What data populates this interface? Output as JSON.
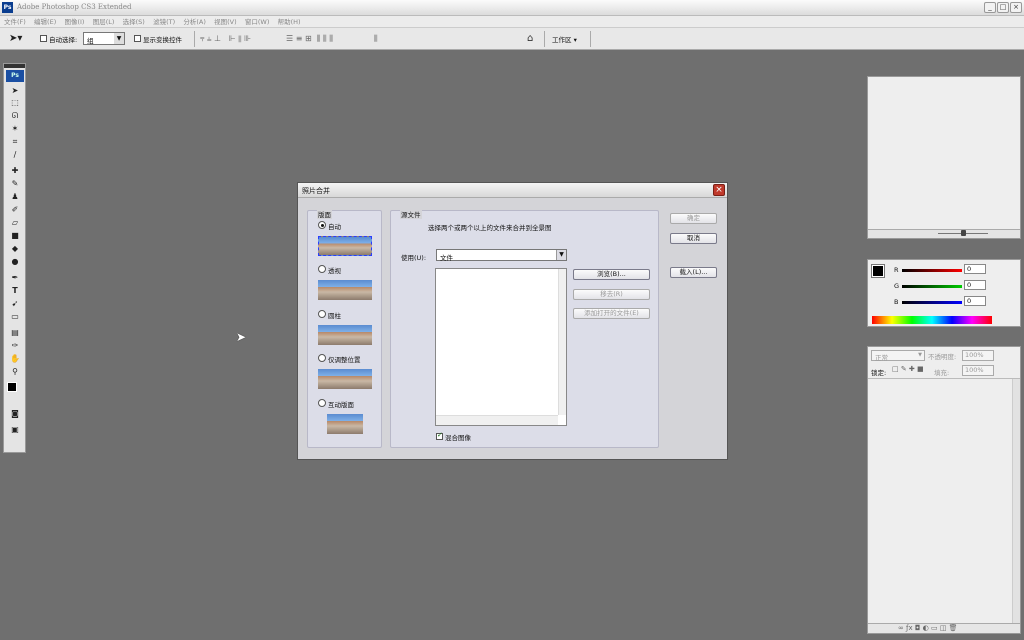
{
  "window": {
    "title": "Adobe Photoshop CS3 Extended",
    "ps_badge": "Ps"
  },
  "menu": [
    "文件(F)",
    "编辑(E)",
    "图像(I)",
    "图层(L)",
    "选择(S)",
    "滤镜(T)",
    "分析(A)",
    "视图(V)",
    "窗口(W)",
    "帮助(H)"
  ],
  "options": {
    "auto_select_label": "自动选择:",
    "auto_select_value": "组",
    "show_transform_label": "显示变换控件",
    "workspace_label": "工作区 ▾"
  },
  "toolbox": {
    "logo": "Ps"
  },
  "dialog": {
    "title": "照片合并",
    "layout_group": "版面",
    "layouts": [
      {
        "label": "自动",
        "selected": true
      },
      {
        "label": "透视",
        "selected": false
      },
      {
        "label": "圆柱",
        "selected": false
      },
      {
        "label": "仅调整位置",
        "selected": false
      },
      {
        "label": "互动版面",
        "selected": false
      }
    ],
    "source_group": "源文件",
    "instruction": "选择两个或两个以上的文件来合并到全景图",
    "use_label": "使用(U):",
    "use_value": "文件",
    "browse_button": "浏览(B)...",
    "remove_button": "移去(R)",
    "add_open_button": "添加打开的文件(E)",
    "blend_label": "混合图像",
    "ok_button": "确定",
    "cancel_button": "取消",
    "load_button": "载入(L)..."
  },
  "color_panel": {
    "r_label": "R",
    "g_label": "G",
    "b_label": "B",
    "r_value": "0",
    "g_value": "0",
    "b_value": "0"
  },
  "layers_panel": {
    "blend_mode": "正常",
    "opacity_label": "不透明度:",
    "opacity_value": "100%",
    "lock_label": "锁定:",
    "fill_label": "填充:",
    "fill_value": "100%"
  }
}
